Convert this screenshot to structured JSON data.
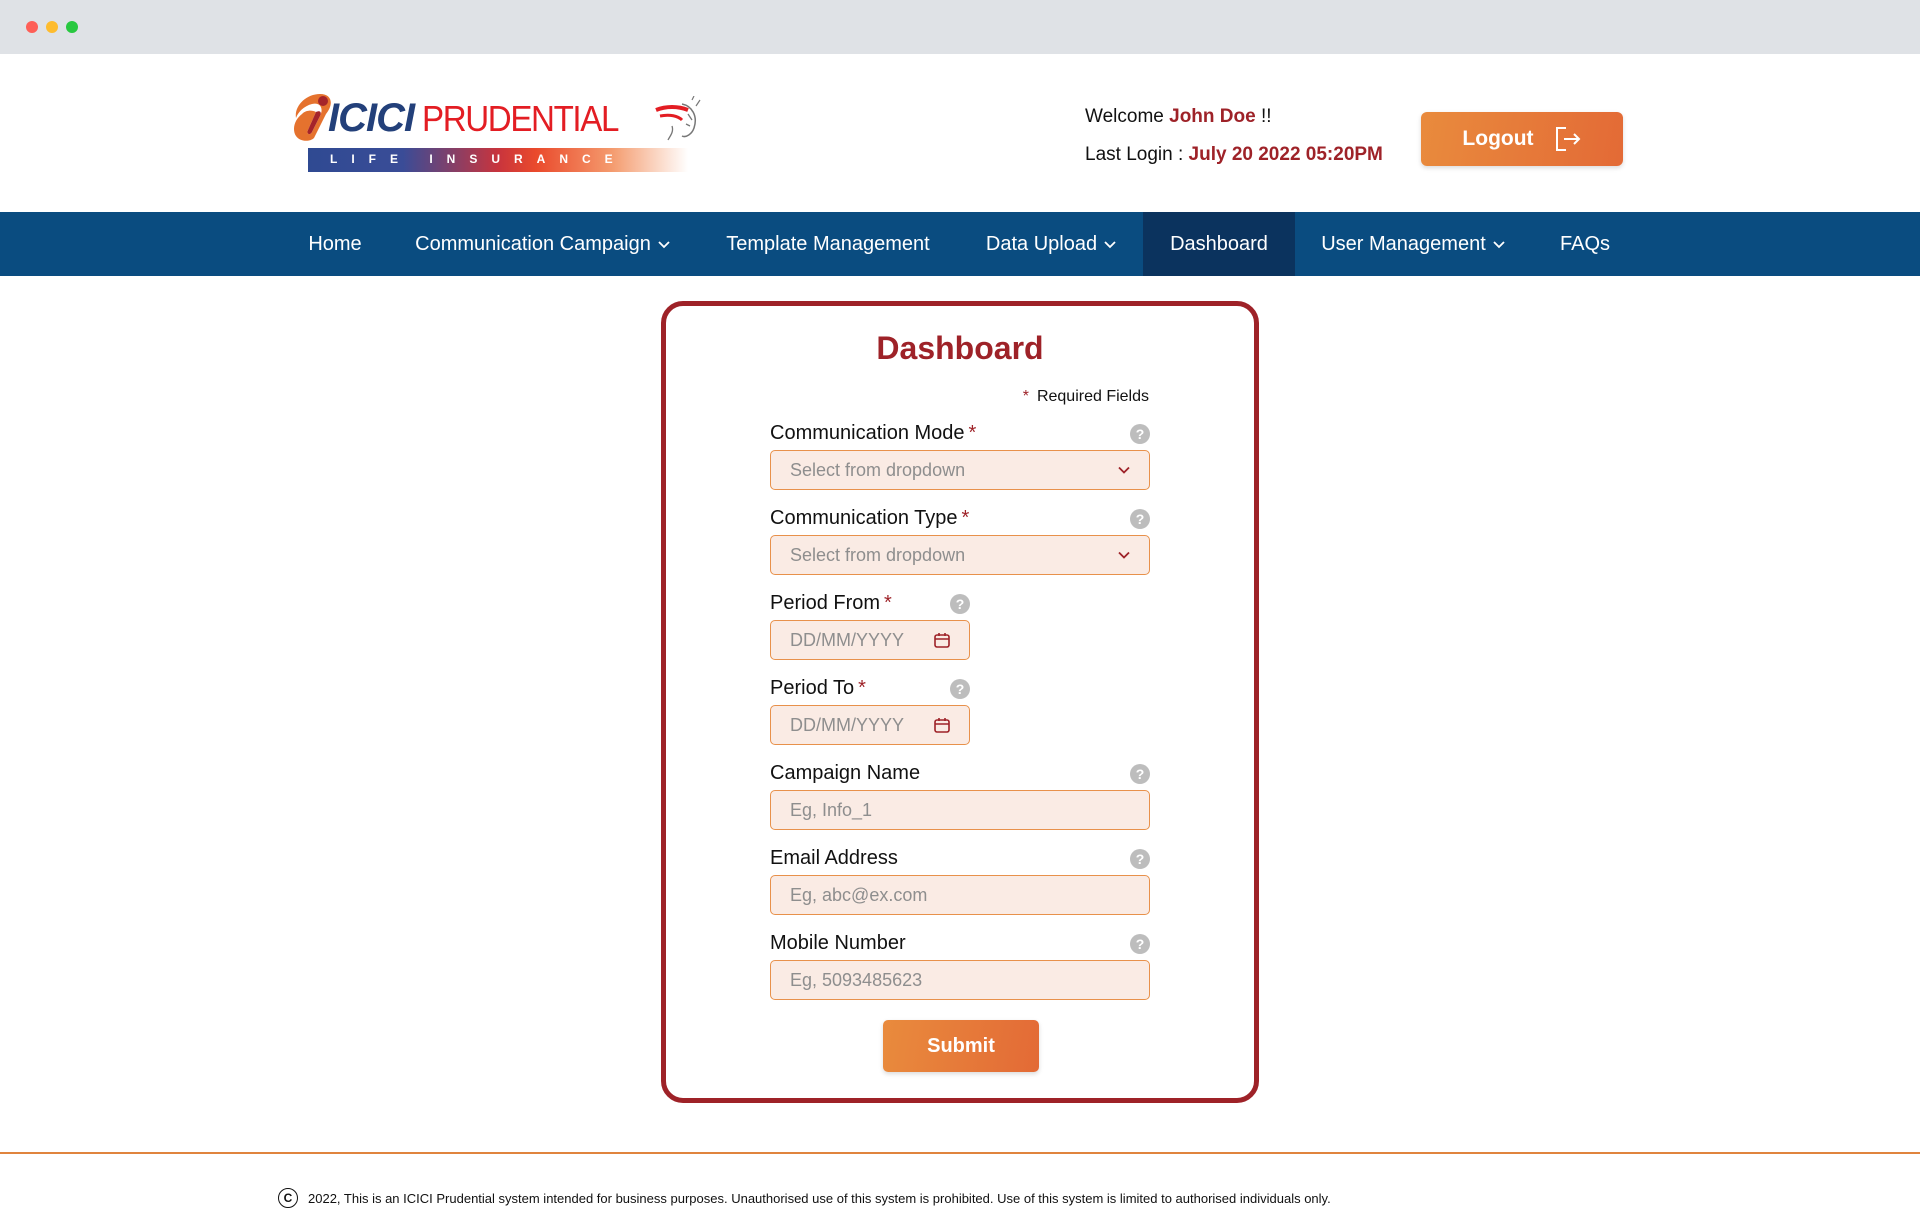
{
  "window": {
    "controls": [
      "close",
      "minimize",
      "maximize"
    ]
  },
  "header": {
    "logo": {
      "brand_primary": "ICICI",
      "brand_secondary": "PRUDENTIAL",
      "tagline": "LIFE INSURANCE"
    },
    "welcome_prefix": "Welcome ",
    "user_name": "John Doe",
    "welcome_suffix": " !!",
    "last_login_label": "Last Login : ",
    "last_login_value": "July 20 2022 05:20PM",
    "logout_label": "Logout",
    "logout_icon": "logout-icon"
  },
  "nav": {
    "items": [
      {
        "label": "Home",
        "has_dropdown": false,
        "active": false
      },
      {
        "label": "Communication Campaign",
        "has_dropdown": true,
        "active": false
      },
      {
        "label": "Template Management",
        "has_dropdown": false,
        "active": false
      },
      {
        "label": "Data Upload",
        "has_dropdown": true,
        "active": false
      },
      {
        "label": "Dashboard",
        "has_dropdown": false,
        "active": true
      },
      {
        "label": "User Management",
        "has_dropdown": true,
        "active": false
      },
      {
        "label": "FAQs",
        "has_dropdown": false,
        "active": false
      }
    ]
  },
  "form": {
    "title": "Dashboard",
    "required_note": "Required Fields",
    "required_marker": "*",
    "help_glyph": "?",
    "fields": [
      {
        "label": "Communication Mode",
        "required": true,
        "type": "select",
        "placeholder": "Select from dropdown",
        "value": ""
      },
      {
        "label": "Communication Type",
        "required": true,
        "type": "select",
        "placeholder": "Select from dropdown",
        "value": ""
      },
      {
        "label": "Period From",
        "required": true,
        "type": "date",
        "placeholder": "DD/MM/YYYY",
        "value": ""
      },
      {
        "label": "Period To",
        "required": true,
        "type": "date",
        "placeholder": "DD/MM/YYYY",
        "value": ""
      },
      {
        "label": "Campaign Name",
        "required": false,
        "type": "text",
        "placeholder": "Eg, Info_1",
        "value": ""
      },
      {
        "label": "Email Address",
        "required": false,
        "type": "text",
        "placeholder": "Eg, abc@ex.com",
        "value": ""
      },
      {
        "label": "Mobile Number",
        "required": false,
        "type": "text",
        "placeholder": "Eg, 5093485623",
        "value": ""
      }
    ],
    "submit_label": "Submit"
  },
  "footer": {
    "copyright_glyph": "C",
    "text": "2022, This is an ICICI Prudential system intended for business purposes. Unauthorised use of this system is prohibited. Use of this system is limited to authorised individuals only."
  },
  "colors": {
    "brand_red": "#9e2228",
    "nav_blue": "#0a4c80",
    "nav_active": "#0b335e",
    "accent_orange": "#e98b3d",
    "input_bg": "#faebe4"
  }
}
